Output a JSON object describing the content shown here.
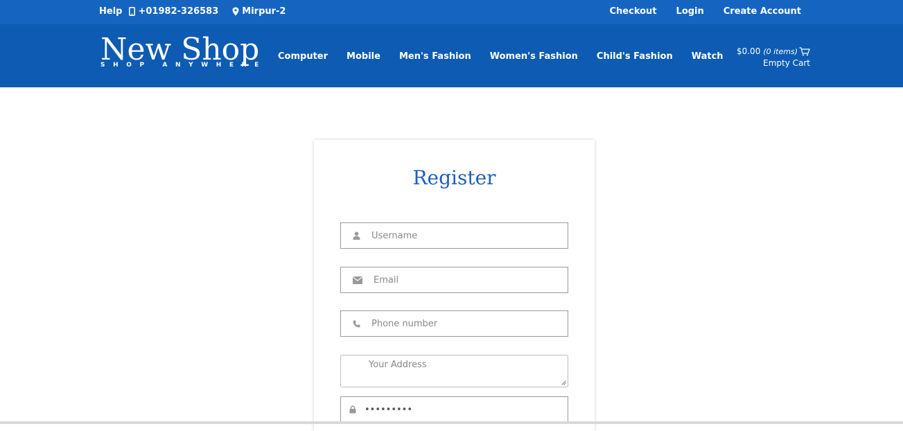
{
  "topbar": {
    "help": "Help",
    "phone": "+01982-326583",
    "location": "Mirpur-2",
    "links": [
      "Checkout",
      "Login",
      "Create Account"
    ]
  },
  "brand": {
    "name": "New Shop",
    "tagline": "SHOP ANYWHERE"
  },
  "menu": [
    "Computer",
    "Mobile",
    "Men's Fashion",
    "Women's Fashion",
    "Child's Fashion",
    "Watch"
  ],
  "cart": {
    "total": "$0.00",
    "items": "(0 items)",
    "status": "Empty Cart"
  },
  "form": {
    "title": "Register",
    "username_placeholder": "Username",
    "email_placeholder": "Email",
    "phone_placeholder": "Phone number",
    "address_placeholder": "Your Address",
    "password_value": "•••••••••"
  },
  "colors": {
    "topbar": "#1565c0",
    "navbar": "#0d5bb3",
    "title": "#1f5fb8"
  }
}
